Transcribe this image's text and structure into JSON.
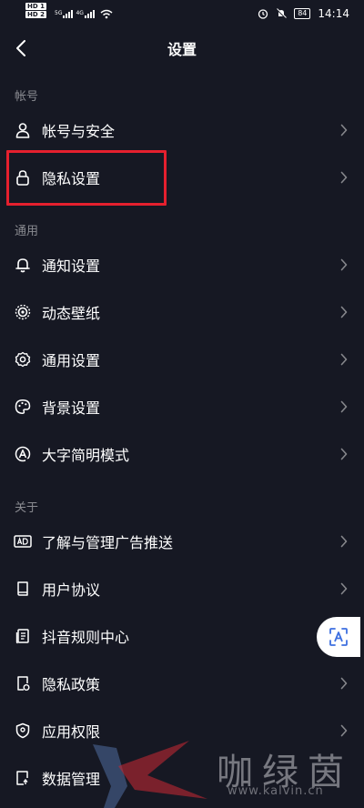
{
  "status_bar": {
    "hd1": "HD 1",
    "hd2": "HD 2",
    "net1": "5G",
    "net2": "4G",
    "battery": "84",
    "time": "14:14"
  },
  "header": {
    "title": "设置"
  },
  "sections": {
    "account": {
      "title": "帐号",
      "items": [
        {
          "label": "帐号与安全",
          "icon": "person-icon"
        },
        {
          "label": "隐私设置",
          "icon": "lock-icon"
        }
      ]
    },
    "general": {
      "title": "通用",
      "items": [
        {
          "label": "通知设置",
          "icon": "bell-icon"
        },
        {
          "label": "动态壁纸",
          "icon": "live-wallpaper-icon"
        },
        {
          "label": "通用设置",
          "icon": "gear-icon"
        },
        {
          "label": "背景设置",
          "icon": "palette-icon"
        },
        {
          "label": "大字简明模式",
          "icon": "font-size-icon"
        }
      ]
    },
    "about": {
      "title": "关于",
      "items": [
        {
          "label": "了解与管理广告推送",
          "icon": "ad-icon"
        },
        {
          "label": "用户协议",
          "icon": "book-icon"
        },
        {
          "label": "抖音规则中心",
          "icon": "document-icon"
        },
        {
          "label": "隐私政策",
          "icon": "privacy-doc-icon"
        },
        {
          "label": "应用权限",
          "icon": "shield-icon"
        },
        {
          "label": "数据管理",
          "icon": "data-icon"
        }
      ]
    }
  },
  "watermark": {
    "chinese": "咖绿茵",
    "url": "www.kalvin.cn"
  },
  "colors": {
    "background": "#161823",
    "text": "#ffffff",
    "section_header": "#8a8b91",
    "highlight": "#e5202e"
  }
}
